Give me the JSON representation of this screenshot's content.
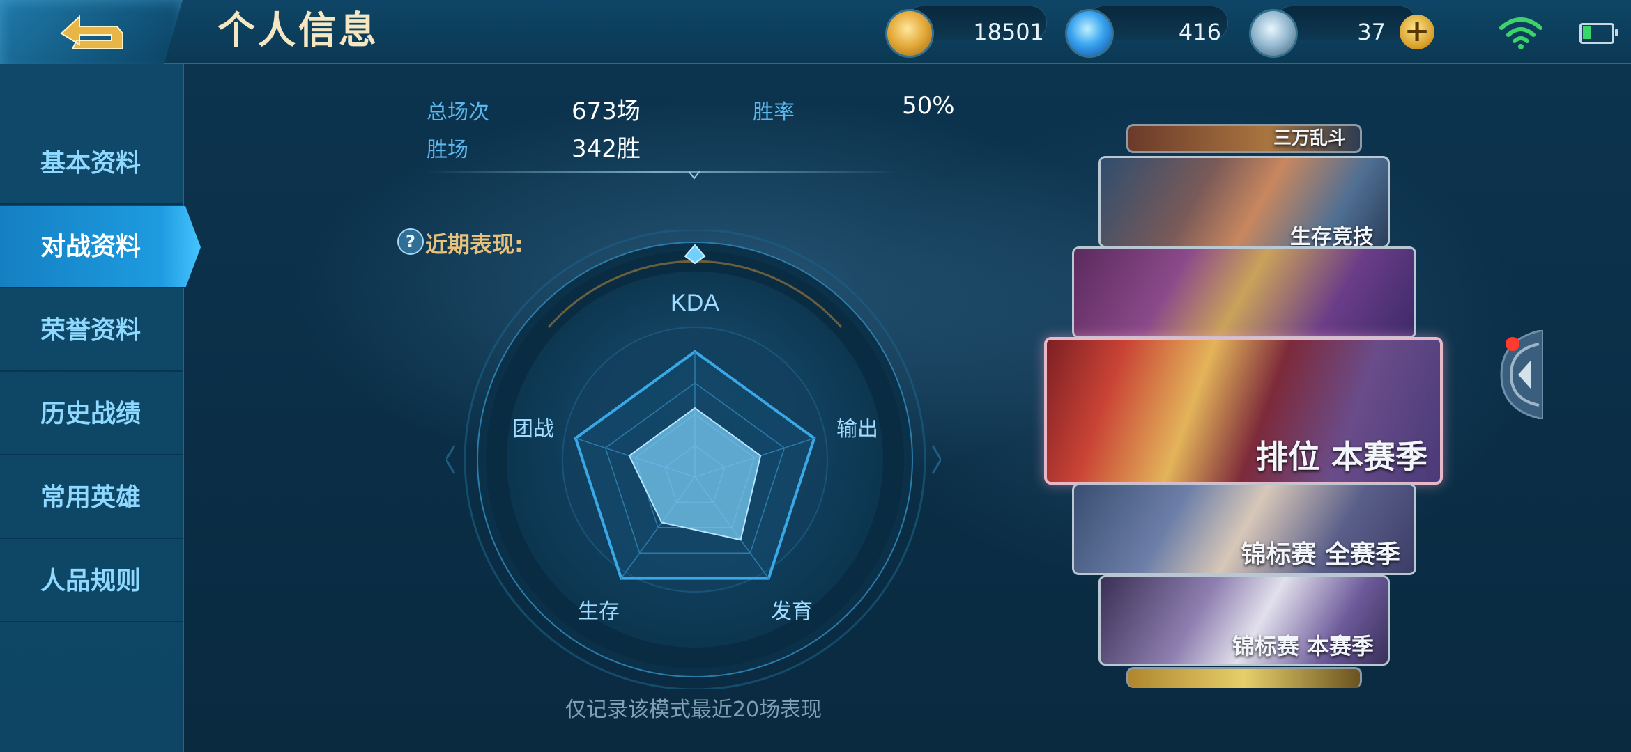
{
  "header": {
    "title": "个人信息",
    "currencies": [
      {
        "name": "gold",
        "icon": "gold-coin-icon",
        "value": "18501"
      },
      {
        "name": "diamond",
        "icon": "diamond-icon",
        "value": "416"
      },
      {
        "name": "coupon",
        "icon": "coupon-icon",
        "value": "37"
      }
    ],
    "add_symbol": "+",
    "battery_level": 0.3
  },
  "sidebar": {
    "items": [
      {
        "label": "基本资料",
        "active": false
      },
      {
        "label": "对战资料",
        "active": true
      },
      {
        "label": "荣誉资料",
        "active": false
      },
      {
        "label": "历史战绩",
        "active": false
      },
      {
        "label": "常用英雄",
        "active": false
      },
      {
        "label": "人品规则",
        "active": false
      }
    ]
  },
  "stats": {
    "total_label": "总场次",
    "total_value": "673场",
    "winrate_label": "胜率",
    "winrate_value": "50%",
    "wins_label": "胜场",
    "wins_value": "342胜"
  },
  "recent": {
    "help_icon": "?",
    "label": "近期表现:",
    "caption": "仅记录该模式最近20场表现",
    "radar": {
      "axes": [
        "KDA",
        "输出",
        "发育",
        "生存",
        "团战"
      ],
      "values": [
        0.55,
        0.55,
        0.62,
        0.45,
        0.55
      ]
    }
  },
  "modes": {
    "cards": [
      {
        "label": "三万乱斗",
        "state": "partial"
      },
      {
        "label": "生存竞技",
        "state": "partial"
      },
      {
        "label": "",
        "state": "partial"
      },
      {
        "label": "排位 本赛季",
        "state": "selected"
      },
      {
        "label": "锦标赛 全赛季",
        "state": "normal"
      },
      {
        "label": "锦标赛 本赛季",
        "state": "normal"
      }
    ]
  },
  "colors": {
    "accent": "#1e9be0",
    "label_blue": "#5cb7ec",
    "gold_text": "#e7c27c"
  }
}
